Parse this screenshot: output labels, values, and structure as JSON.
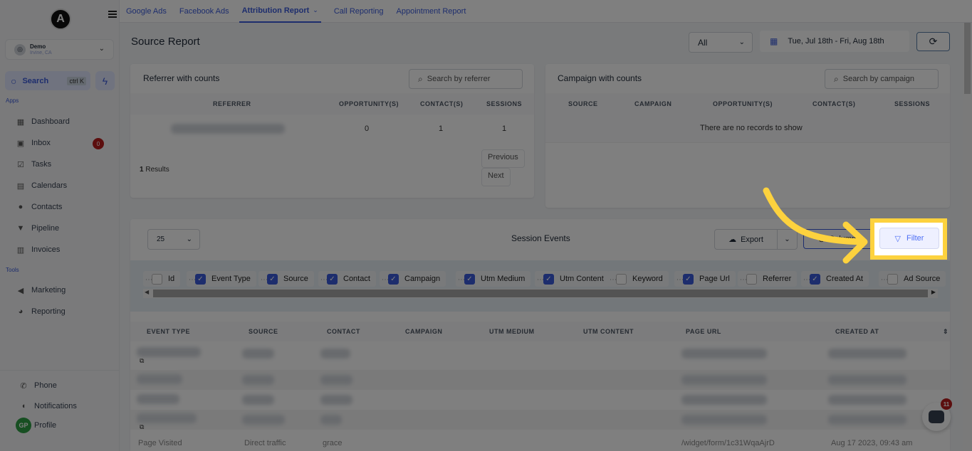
{
  "sidebar": {
    "logo_letter": "A",
    "account": {
      "name": "Demo",
      "location": "Irvine, CA"
    },
    "search": {
      "label": "Search",
      "shortcut": "ctrl K"
    },
    "sections": {
      "apps": "Apps",
      "tools": "Tools"
    },
    "apps_items": [
      {
        "label": "Dashboard",
        "icon": "dashboard-icon"
      },
      {
        "label": "Inbox",
        "icon": "inbox-icon",
        "badge": "0"
      },
      {
        "label": "Tasks",
        "icon": "tasks-icon"
      },
      {
        "label": "Calendars",
        "icon": "calendar-icon"
      },
      {
        "label": "Contacts",
        "icon": "contacts-icon"
      },
      {
        "label": "Pipeline",
        "icon": "pipeline-icon"
      },
      {
        "label": "Invoices",
        "icon": "invoice-icon"
      }
    ],
    "tools_items": [
      {
        "label": "Marketing",
        "icon": "megaphone-icon"
      },
      {
        "label": "Reporting",
        "icon": "pie-chart-icon"
      }
    ],
    "bottom": {
      "phone": "Phone",
      "notifications": "Notifications",
      "profile": "Profile",
      "profile_initials": "GP"
    }
  },
  "topnav": {
    "tabs": [
      "Google Ads",
      "Facebook Ads",
      "Attribution Report",
      "Call Reporting",
      "Appointment Report"
    ],
    "active_tab": "Attribution Report"
  },
  "header": {
    "title": "Source Report",
    "filter_select": "All",
    "date_range": "Tue, Jul 18th - Fri, Aug 18th"
  },
  "referrer_card": {
    "title": "Referrer with counts",
    "search_placeholder": "Search by referrer",
    "columns": [
      "REFERRER",
      "OPPORTUNITY(S)",
      "CONTACT(S)",
      "SESSIONS"
    ],
    "rows": [
      {
        "referrer": "",
        "opportunities": "0",
        "contacts": "1",
        "sessions": "1"
      }
    ],
    "results_count": "1",
    "results_label": "Results",
    "prev_label": "Previous",
    "next_label": "Next"
  },
  "campaign_card": {
    "title": "Campaign with counts",
    "search_placeholder": "Search by campaign",
    "columns": [
      "SOURCE",
      "CAMPAIGN",
      "OPPORTUNITY(S)",
      "CONTACT(S)",
      "SESSIONS"
    ],
    "empty_text": "There are no records to show"
  },
  "session_events": {
    "title": "Session Events",
    "per_page": "25",
    "export_label": "Export",
    "columns_label": "Columns",
    "filter_label": "Filter",
    "column_chips": [
      {
        "label": "Id",
        "checked": false
      },
      {
        "label": "Event Type",
        "checked": true
      },
      {
        "label": "Source",
        "checked": true
      },
      {
        "label": "Contact",
        "checked": true
      },
      {
        "label": "Campaign",
        "checked": true
      },
      {
        "label": "Utm Medium",
        "checked": true
      },
      {
        "label": "Utm Content",
        "checked": true
      },
      {
        "label": "Keyword",
        "checked": false
      },
      {
        "label": "Page Url",
        "checked": true
      },
      {
        "label": "Referrer",
        "checked": false
      },
      {
        "label": "Created At",
        "checked": true
      },
      {
        "label": "Ad Source",
        "checked": false
      }
    ],
    "table_columns": [
      "EVENT TYPE",
      "SOURCE",
      "CONTACT",
      "CAMPAIGN",
      "UTM MEDIUM",
      "UTM CONTENT",
      "PAGE URL",
      "CREATED AT"
    ],
    "visible_last_row": {
      "event_type": "Page Visited",
      "source": "Direct traffic",
      "contact": "grace",
      "page_url": "/widget/form/1c31WqaAjrD",
      "created_at": "Aug 17 2023, 09:43 am"
    }
  },
  "chat_widget": {
    "badge": "11"
  },
  "colors": {
    "accent": "#3b5bdb",
    "highlight": "#fdd23e",
    "badge_red": "#b91c1c",
    "profile_green": "#2f9e44"
  }
}
